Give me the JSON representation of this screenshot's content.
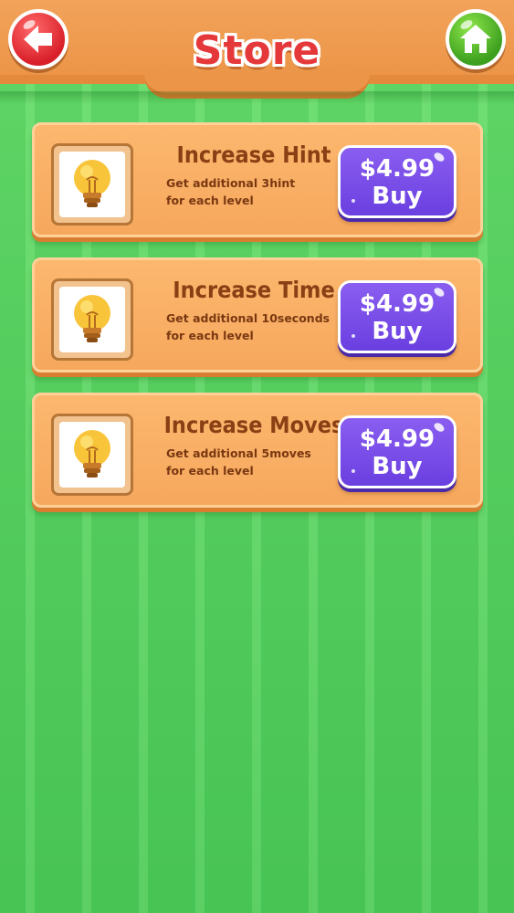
{
  "header": {
    "title": "Store",
    "back_icon": "arrow-left-icon",
    "home_icon": "home-icon"
  },
  "colors": {
    "title_red": "#e5383a",
    "header_orange": "#f2a35a",
    "card_orange": "#f6a85d",
    "buy_purple": "#7a4ee8",
    "background_green": "#52cc5c"
  },
  "items": [
    {
      "title": "Increase Hint",
      "desc_line1": "Get additional 3hint",
      "desc_line2": "for each level",
      "icon": "lightbulb-icon",
      "price": "$4.99",
      "buy_label": "Buy"
    },
    {
      "title": "Increase Time",
      "desc_line1": "Get additional 10seconds",
      "desc_line2": "for each level",
      "icon": "lightbulb-icon",
      "price": "$4.99",
      "buy_label": "Buy"
    },
    {
      "title": "Increase Moves",
      "desc_line1": "Get additional 5moves",
      "desc_line2": "for each level",
      "icon": "lightbulb-icon",
      "price": "$4.99",
      "buy_label": "Buy"
    }
  ]
}
